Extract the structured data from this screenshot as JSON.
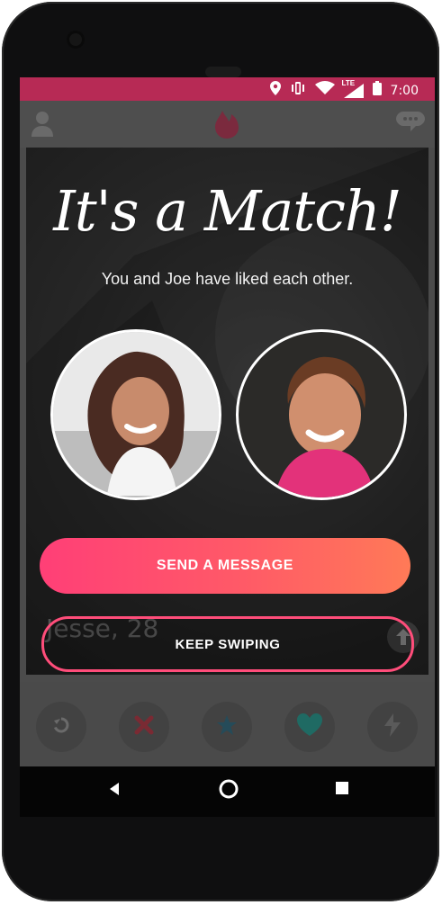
{
  "status_bar": {
    "time": "7:00",
    "network_label": "LTE",
    "icons": [
      "location-icon",
      "vibrate-icon",
      "wifi-icon",
      "signal-icon",
      "battery-icon"
    ]
  },
  "top_bar": {
    "left_icon": "profile-icon",
    "center_icon": "flame-logo-icon",
    "right_icon": "messages-icon"
  },
  "match_overlay": {
    "title": "It's a Match!",
    "subtitle": "You and Joe have liked each other.",
    "primary_button": "SEND A MESSAGE",
    "secondary_button": "KEEP SWIPING"
  },
  "card": {
    "name_age": "Jesse, 28"
  },
  "bottom_actions": [
    "rewind-icon",
    "nope-icon",
    "superlike-icon",
    "like-icon",
    "boost-icon"
  ],
  "nav_bar": [
    "back-icon",
    "home-icon",
    "recents-icon"
  ],
  "colors": {
    "status_bar": "#b72a55",
    "primary_gradient_start": "#ff3f77",
    "primary_gradient_end": "#ff7a57",
    "outline": "#ff4d7a"
  }
}
